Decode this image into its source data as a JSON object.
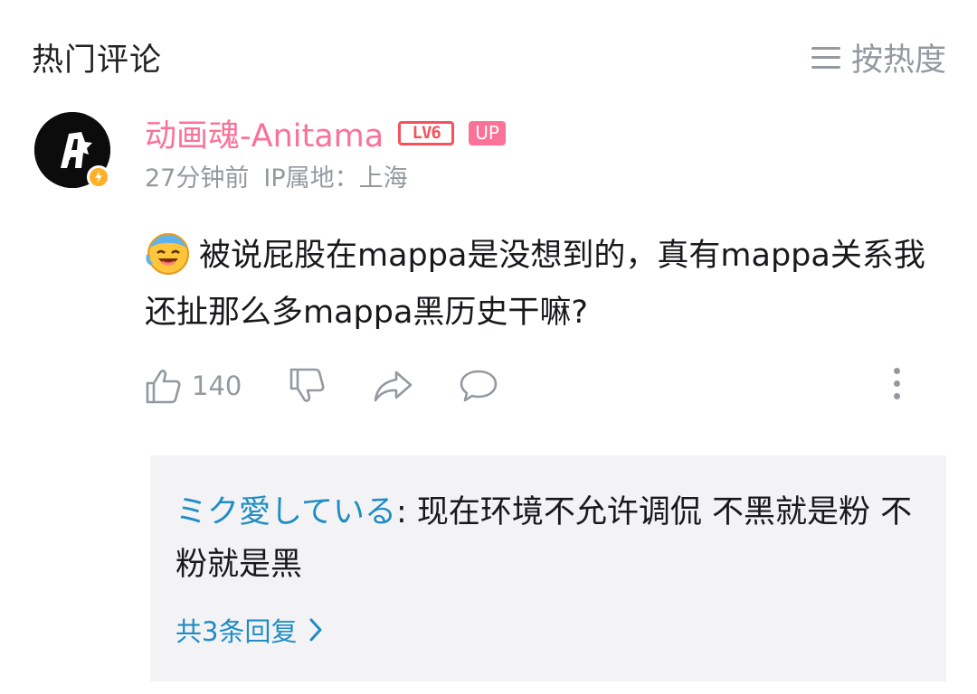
{
  "header": {
    "title": "热门评论",
    "sort_label": "按热度"
  },
  "comment": {
    "username": "动画魂-Anitama",
    "level": "LV6",
    "up_badge": "UP",
    "time": "27分钟前",
    "ip": "IP属地：上海",
    "text": "被说屁股在mappa是没想到的，真有mappa关系我还扯那么多mappa黑历史干嘛?",
    "emoji": "laughing-crying-emoji",
    "like_count": "140"
  },
  "reply": {
    "username": "ミク愛している",
    "separator": ": ",
    "text": "现在环境不允许调侃 不黑就是粉 不粉就是黑",
    "more_label": "共3条回复"
  },
  "colors": {
    "username": "#fb7299",
    "level": "#f6515c",
    "link": "#1f8dc4",
    "muted": "#9499a0",
    "reply_bg": "#f3f3f5"
  }
}
